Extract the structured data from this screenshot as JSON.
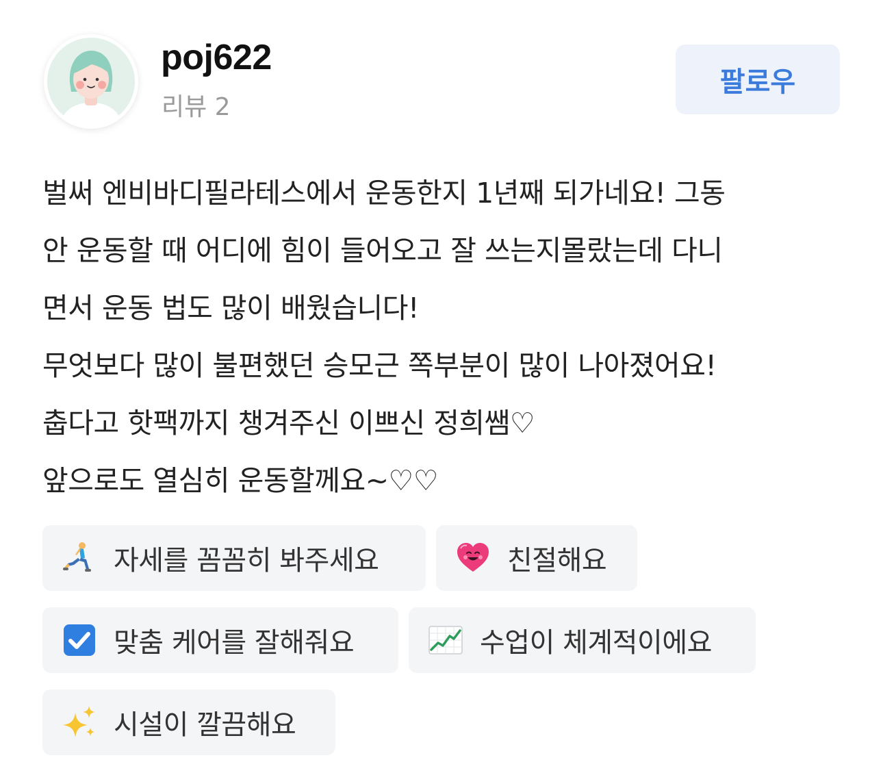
{
  "profile": {
    "username": "poj622",
    "review_count": "리뷰 2",
    "follow_label": "팔로우",
    "avatar_icon": "avatar-icon"
  },
  "review": {
    "lines": [
      "벌써 엔비바디필라테스에서 운동한지 1년째 되가네요! 그동",
      "안 운동할 때 어디에 힘이 들어오고 잘 쓰는지몰랐는데 다니",
      "면서 운동 법도 많이 배웠습니다!",
      "무엇보다 많이 불편했던 승모근 쪽부분이 많이 나아졌어요!",
      "춥다고 핫팩까지 챙겨주신 이쁘신 정희쌤♡",
      "앞으로도 열심히 운동할께요~♡♡"
    ]
  },
  "tags": [
    {
      "label": "자세를 꼼꼼히 봐주세요",
      "icon": "lunge-person-icon"
    },
    {
      "label": "친절해요",
      "icon": "smiling-heart-icon"
    },
    {
      "label": "맞춤 케어를 잘해줘요",
      "icon": "checkbox-icon"
    },
    {
      "label": "수업이 체계적이에요",
      "icon": "chart-increasing-icon"
    },
    {
      "label": "시설이 깔끔해요",
      "icon": "sparkles-icon"
    }
  ],
  "colors": {
    "accent": "#3a7bdc",
    "follow_bg": "#eef3fb",
    "tag_bg": "#f4f5f7",
    "muted_text": "#9a9a9a"
  }
}
